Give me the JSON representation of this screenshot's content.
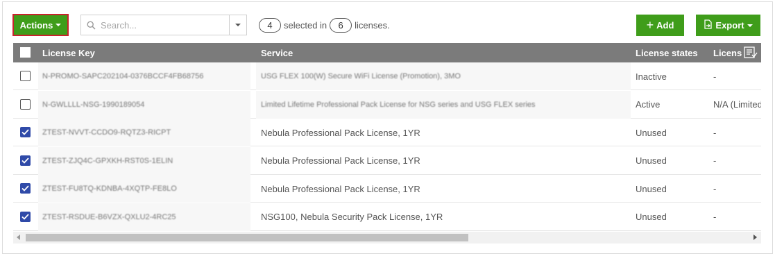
{
  "toolbar": {
    "actions_label": "Actions",
    "search_placeholder": "Search...",
    "selected_count": "4",
    "selected_text": "selected in",
    "total_count": "6",
    "total_text": "licenses.",
    "add_label": "Add",
    "export_label": "Export"
  },
  "colors": {
    "accent_green": "#3f9d1a",
    "header_gray": "#7b7b7b",
    "checkbox_blue": "#2f4aa8",
    "highlight_red": "#c8232c"
  },
  "table": {
    "columns": [
      "License Key",
      "Service",
      "License states",
      "Licens"
    ],
    "rows": [
      {
        "checked": false,
        "key": "N-PROMO-SAPC202104-0376BCCF4FB68756",
        "service": "USG FLEX 100(W) Secure WiFi License (Promotion), 3MO",
        "state": "Inactive",
        "license": "-",
        "blur_service": true
      },
      {
        "checked": false,
        "key": "N-GWLLLL-NSG-1990189054",
        "service": "Limited Lifetime Professional Pack License for NSG series and USG FLEX series",
        "state": "Active",
        "license": "N/A (Limited",
        "blur_service": true
      },
      {
        "checked": true,
        "key": "ZTEST-NVVT-CCDO9-RQTZ3-RICPT",
        "service": "Nebula Professional Pack License, 1YR",
        "state": "Unused",
        "license": "-",
        "blur_service": false
      },
      {
        "checked": true,
        "key": "ZTEST-ZJQ4C-GPXKH-RST0S-1ELIN",
        "service": "Nebula Professional Pack License, 1YR",
        "state": "Unused",
        "license": "-",
        "blur_service": false
      },
      {
        "checked": true,
        "key": "ZTEST-FU8TQ-KDNBA-4XQTP-FE8LO",
        "service": "Nebula Professional Pack License, 1YR",
        "state": "Unused",
        "license": "-",
        "blur_service": false
      },
      {
        "checked": true,
        "key": "ZTEST-RSDUE-B6VZX-QXLU2-4RC25",
        "service": "NSG100, Nebula Security Pack License, 1YR",
        "state": "Unused",
        "license": "-",
        "blur_service": false
      }
    ]
  },
  "icons": {
    "search": "search-icon",
    "plus": "plus-icon",
    "export": "export-file-icon",
    "filter": "column-filter-icon"
  },
  "scroll": {
    "horizontal_position": 0
  }
}
